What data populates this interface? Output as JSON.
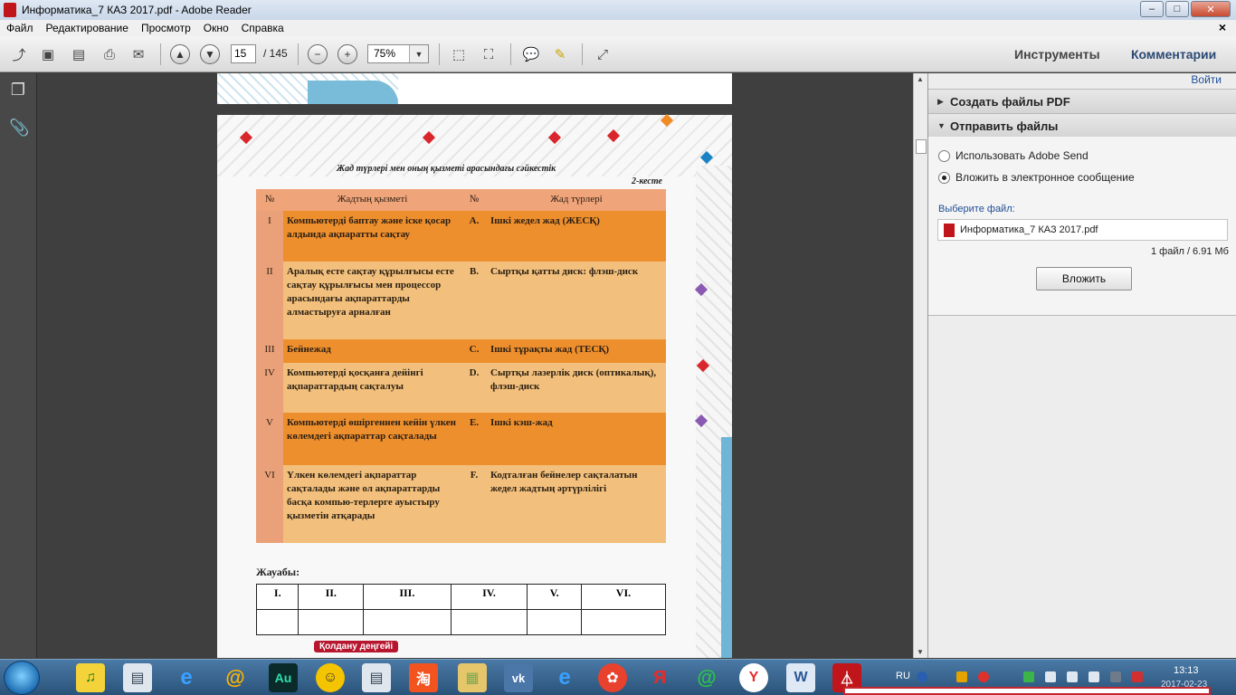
{
  "window": {
    "title": "Информатика_7 КАЗ 2017.pdf - Adobe Reader",
    "min": "–",
    "max": "□",
    "close": "✕"
  },
  "menu": [
    "Файл",
    "Редактирование",
    "Просмотр",
    "Окно",
    "Справка"
  ],
  "menu_close": "×",
  "toolbar": {
    "page_current": "15",
    "page_total": "/ 145",
    "zoom": "75%",
    "tools_label": "Инструменты",
    "comments_label": "Комментарии"
  },
  "document": {
    "table_title": "Жад түрлері мен оның қызметі арасындағы сәйкестік",
    "table_number": "2-кесте",
    "headers": [
      "№",
      "Жадтың қызметі",
      "№",
      "Жад түрлері"
    ],
    "rows": [
      {
        "num": "I",
        "func": "Компьютерді баптау және іске қосар алдында ақпаратты сақтау",
        "letter": "A.",
        "type": "Ішкі жедел жад (ЖЕСҚ)"
      },
      {
        "num": "II",
        "func": "Аралық есте сақтау құрылғысы есте сақтау құрылғысы мен процессор арасындағы ақпараттарды алмастыруға арналған",
        "letter": "B.",
        "type": "Сыртқы қатты диск: флэш-диск"
      },
      {
        "num": "III",
        "func": "Бейнежад",
        "letter": "C.",
        "type": "Ішкі тұрақты жад (ТЕСҚ)"
      },
      {
        "num": "IV",
        "func": "Компьютерді қосқанға дейінгі ақпараттардың сақталуы",
        "letter": "D.",
        "type": "Сыртқы лазерлік диск (оптикалық), флэш-диск"
      },
      {
        "num": "V",
        "func": "Компьютерді өшіргеннен кейін үлкен көлемдегі ақпараттар сақталады",
        "letter": "E.",
        "type": "Ішкі кэш-жад"
      },
      {
        "num": "VI",
        "func": "Үлкен көлемдегі ақпараттар сақталады және ол ақпараттарды басқа компью-терлерге ауыстыру қызметін атқарады",
        "letter": "F.",
        "type": "Кодталған бейнелер сақталатын жедел жадтың әртүрлілігі"
      }
    ],
    "answer_label": "Жауабы:",
    "answer_headers": [
      "I.",
      "II.",
      "III.",
      "IV.",
      "V.",
      "VI."
    ],
    "level_badge": "Қолдану деңгейі"
  },
  "panel": {
    "signin": "Войти",
    "section_create": "Создать файлы PDF",
    "section_send": "Отправить файлы",
    "option_adobe_send": "Использовать Adobe Send",
    "option_email": "Вложить в электронное сообщение",
    "selected_option": "email",
    "choose_file": "Выберите файл:",
    "file_name": "Информатика_7 КАЗ 2017.pdf",
    "file_info": "1 файл / 6.91 Мб",
    "attach_button": "Вложить"
  },
  "taskbar": {
    "apps": [
      "music",
      "document",
      "internet-explorer",
      "mail",
      "audition",
      "chat",
      "document",
      "taobao",
      "folder",
      "vk",
      "internet-explorer",
      "media-player",
      "yandex",
      "chat-green",
      "yandex-browser",
      "word",
      "adobe-reader"
    ],
    "language": "RU",
    "time": "13:13",
    "date": "2017-02-23"
  }
}
